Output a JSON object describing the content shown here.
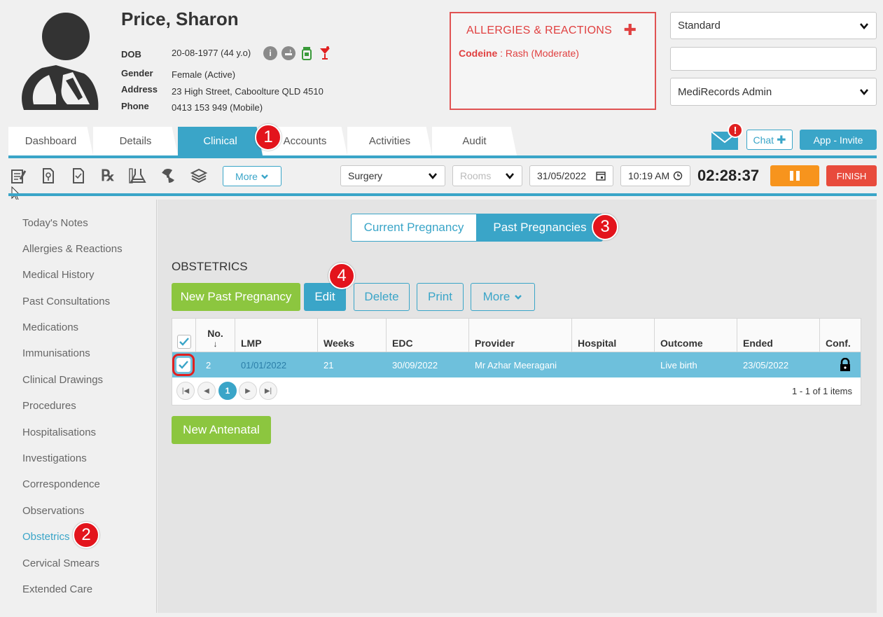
{
  "patient": {
    "name": "Price, Sharon",
    "dob_label": "DOB",
    "dob_value": "20-08-1977 (44 y.o)",
    "gender_label": "Gender",
    "gender_value": "Female (Active)",
    "address_label": "Address",
    "address_value": "23 High Street, Caboolture QLD 4510",
    "phone_label": "Phone",
    "phone_value": "0413 153 949 (Mobile)"
  },
  "allergies": {
    "title": "ALLERGIES & REACTIONS",
    "item_name": "Codeine",
    "item_sep": " : ",
    "item_detail": "Rash (Moderate)"
  },
  "right_panel": {
    "select1": "Standard",
    "input_value": "",
    "select2": "MediRecords Admin"
  },
  "tabs": [
    {
      "label": "Dashboard"
    },
    {
      "label": "Details"
    },
    {
      "label": "Clinical"
    },
    {
      "label": "Accounts"
    },
    {
      "label": "Activities"
    },
    {
      "label": "Audit"
    }
  ],
  "header_buttons": {
    "mail_badge": "!",
    "chat": "Chat",
    "app_invite": "App - Invite"
  },
  "toolbar": {
    "more": "More",
    "surgery": "Surgery",
    "rooms_placeholder": "Rooms",
    "date": "31/05/2022",
    "time": "10:19 AM",
    "timer": "02:28:37",
    "finish": "FINISH"
  },
  "sidebar": {
    "items": [
      "Today's Notes",
      "Allergies & Reactions",
      "Medical History",
      "Past Consultations",
      "Medications",
      "Immunisations",
      "Clinical Drawings",
      "Procedures",
      "Hospitalisations",
      "Investigations",
      "Correspondence",
      "Observations",
      "Obstetrics",
      "Cervical Smears",
      "Extended Care"
    ]
  },
  "main": {
    "seg_current": "Current Pregnancy",
    "seg_past": "Past Pregnancies",
    "section_title": "OBSTETRICS",
    "btn_new_past": "New Past Pregnancy",
    "btn_edit": "Edit",
    "btn_delete": "Delete",
    "btn_print": "Print",
    "btn_more": "More",
    "btn_new_antenatal": "New Antenatal"
  },
  "grid": {
    "headers": {
      "no": "No.",
      "no_sort": "↓",
      "lmp": "LMP",
      "weeks": "Weeks",
      "edc": "EDC",
      "provider": "Provider",
      "hospital": "Hospital",
      "outcome": "Outcome",
      "ended": "Ended",
      "conf": "Conf."
    },
    "row": {
      "no": "2",
      "lmp": "01/01/2022",
      "weeks": "21",
      "edc": "30/09/2022",
      "provider": "Mr Azhar Meeragani",
      "hospital": "",
      "outcome": "Live birth",
      "ended": "23/05/2022"
    },
    "pager": {
      "current_page": "1",
      "items_count": "1 - 1 of 1 items"
    }
  },
  "markers": [
    "1",
    "2",
    "3",
    "4"
  ],
  "colors": {
    "accent": "#3aa5c8",
    "green": "#8cc63f",
    "alert_red": "#e04040",
    "pause_orange": "#f7941d",
    "finish_red": "#e84b3c",
    "selected_row": "#6ec0dc"
  }
}
